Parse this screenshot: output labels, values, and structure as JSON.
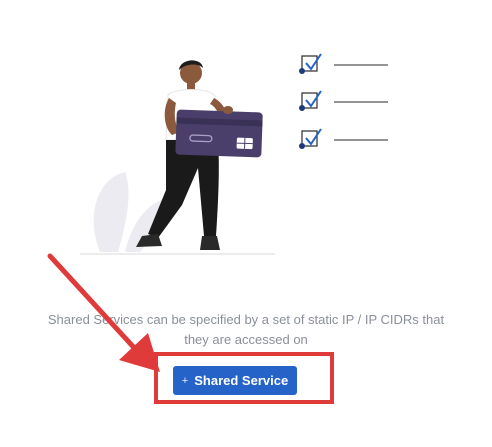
{
  "empty_state": {
    "description_line1": "Shared Services can be specified by a set of static IP / IP CIDRs that",
    "description_line2": "they are accessed on",
    "button_icon": "+",
    "button_label": "Shared Service"
  },
  "colors": {
    "accent": "#2563c9",
    "annotation": "#e03b3b",
    "muted_text": "#8a8f99",
    "card": "#4a3f6b"
  },
  "icons": {
    "checklist": "checkbox-checked-icon",
    "annotation_arrow": "arrow-icon"
  }
}
